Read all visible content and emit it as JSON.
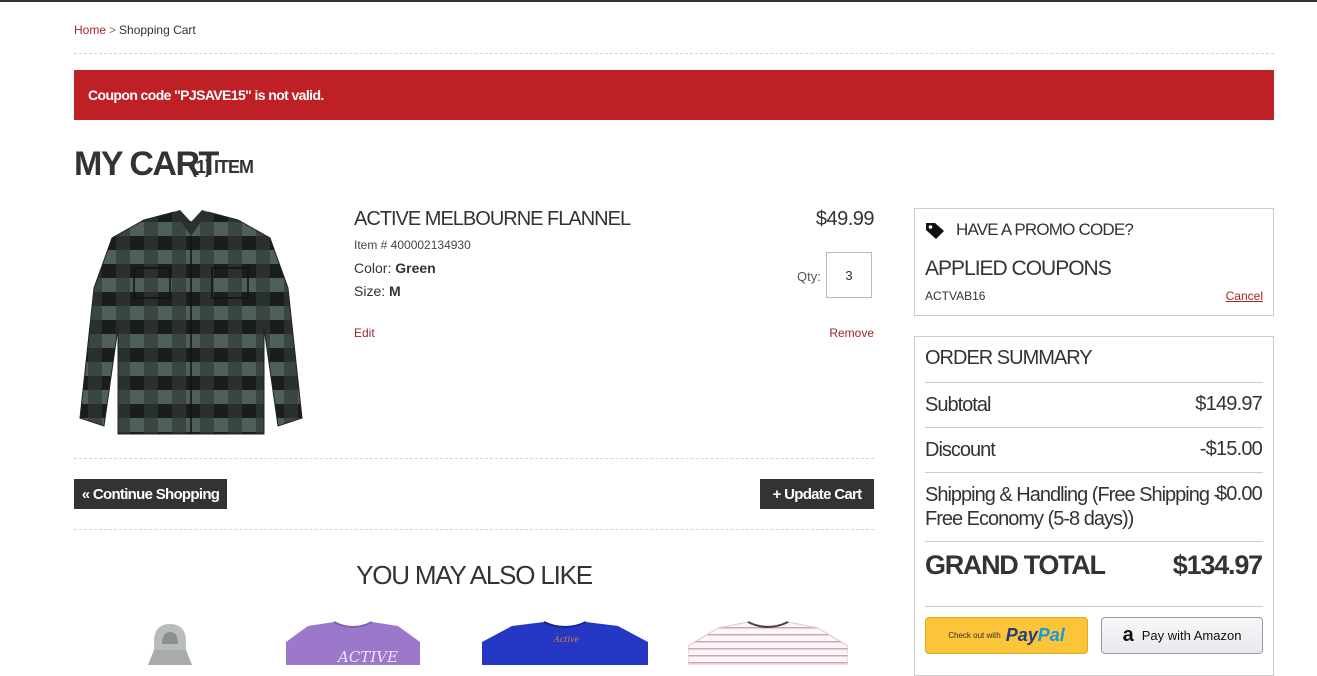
{
  "breadcrumb": {
    "home": "Home",
    "separator": ">",
    "current": "Shopping Cart"
  },
  "alert": {
    "message": "Coupon code \"PJSAVE15\" is not valid.",
    "color": "#be2025"
  },
  "cart": {
    "title": "MY CART",
    "count": "(1) ITEM"
  },
  "item": {
    "name": "ACTIVE MELBOURNE FLANNEL",
    "sku": "Item # 400002134930",
    "color_label": "Color:",
    "color_value": "Green",
    "size_label": "Size:",
    "size_value": "M",
    "price": "$49.99",
    "qty_label": "Qty:",
    "qty_value": "3",
    "edit": "Edit",
    "remove": "Remove",
    "image_icon": "plaid-flannel-shirt"
  },
  "actions": {
    "continue": "« Continue Shopping",
    "update": "+ Update Cart"
  },
  "recommendations": {
    "title": "YOU MAY ALSO LIKE",
    "items": [
      {
        "icon": "grey-hoodie"
      },
      {
        "icon": "purple-tshirt"
      },
      {
        "icon": "blue-tshirt"
      },
      {
        "icon": "striped-tshirt"
      }
    ]
  },
  "promo": {
    "title": "HAVE A PROMO CODE?",
    "applied_title": "APPLIED COUPONS",
    "code": "ACTVAB16",
    "cancel": "Cancel"
  },
  "summary": {
    "title": "ORDER SUMMARY",
    "subtotal_label": "Subtotal",
    "subtotal": "$149.97",
    "discount_label": "Discount",
    "discount": "-$15.00",
    "shipping_label_1": "Shipping & Handling (Free Shipping -",
    "shipping_label_2": "Free Economy (5-8 days))",
    "shipping": "$0.00",
    "grand_total_label": "GRAND TOTAL",
    "grand_total": "$134.97"
  },
  "checkout": {
    "paypal_prefix": "Check out with",
    "paypal_brand_1": "Pay",
    "paypal_brand_2": "Pal",
    "amazon_label": "Pay with Amazon"
  },
  "colors": {
    "accent": "#a3242a",
    "dark_button": "#333333",
    "paypal_yellow": "#fcc439"
  }
}
